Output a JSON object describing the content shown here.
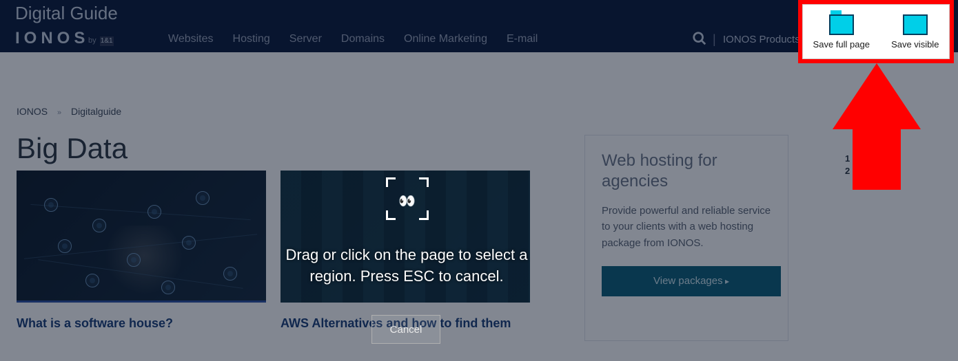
{
  "header": {
    "brand_top": "Digital Guide",
    "brand_logo": "IONOS",
    "brand_by": "by",
    "brand_box": "1&1",
    "nav": [
      "Websites",
      "Hosting",
      "Server",
      "Domains",
      "Online Marketing",
      "E-mail"
    ],
    "separator": "|",
    "products_link": "IONOS Products"
  },
  "breadcrumb": {
    "a": "IONOS",
    "sep": "»",
    "b": "Digitalguide"
  },
  "page_title": "Big Data",
  "cards": [
    {
      "title": "What is a software house?"
    },
    {
      "title": "AWS Alternatives and how to find them"
    }
  ],
  "promo": {
    "title": "Web hosting for agencies",
    "text": "Provide powerful and reliable service to your clients with a web hosting package from IONOS.",
    "button": "View packages"
  },
  "side_nums": {
    "a": "1",
    "b": "2"
  },
  "tool": {
    "message": "Drag or click on the page to select a region. Press ESC to cancel.",
    "cancel": "Cancel"
  },
  "extension": {
    "btn1": "Save full page",
    "btn2": "Save visible"
  }
}
